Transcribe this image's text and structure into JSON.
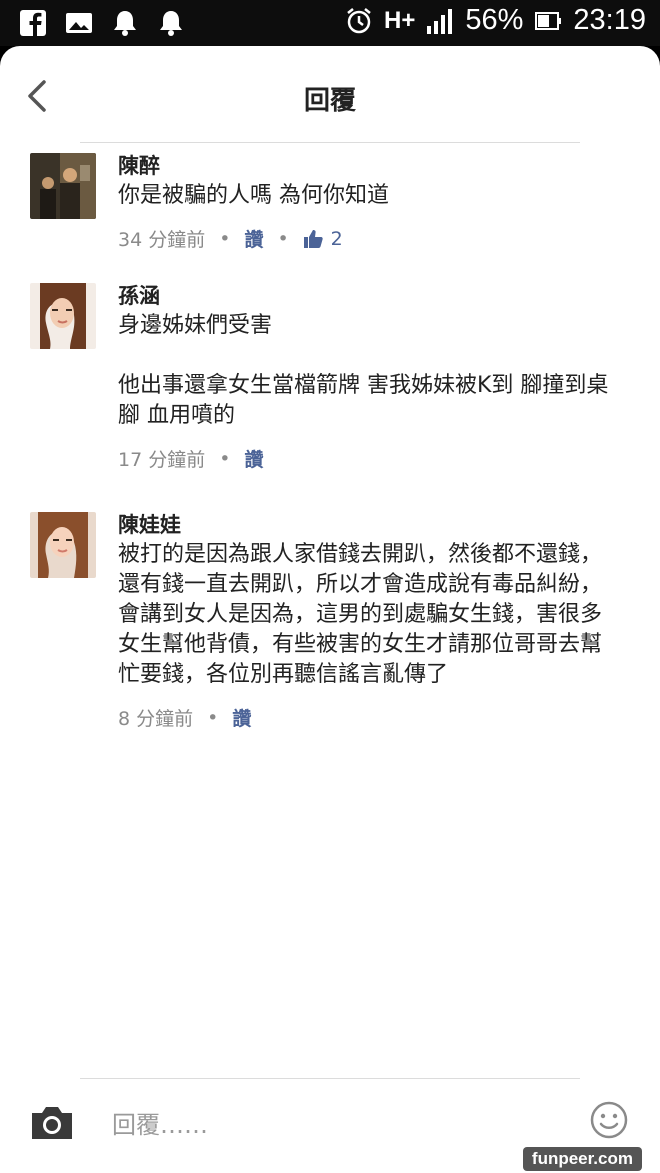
{
  "status_bar": {
    "battery_percent": "56%",
    "time": "23:19",
    "network": "H+",
    "icons": [
      "facebook-icon",
      "photo-icon",
      "bell-icon",
      "bell-icon",
      "alarm-icon",
      "signal-icon",
      "battery-icon"
    ]
  },
  "header": {
    "title": "回覆"
  },
  "comments": [
    {
      "name": "陳醉",
      "text": "你是被騙的人嗎 為何你知道",
      "time": "34 分鐘前",
      "like_label": "讚",
      "like_count": "2"
    },
    {
      "name": "孫涵",
      "text": "身邊姊妹們受害\n\n他出事還拿女生當檔箭牌 害我姊妹被K到 腳撞到桌腳 血用噴的",
      "time": "17 分鐘前",
      "like_label": "讚"
    },
    {
      "name": "陳娃娃",
      "text": "被打的是因為跟人家借錢去開趴，然後都不還錢，還有錢一直去開趴，所以才會造成說有毒品糾紛，會講到女人是因為，這男的到處騙女生錢，害很多女生幫他背債，有些被害的女生才請那位哥哥去幫忙要錢，各位別再聽信謠言亂傳了",
      "time": "8 分鐘前",
      "like_label": "讚"
    }
  ],
  "composer": {
    "placeholder": "回覆……"
  },
  "watermark": "funpeer.com",
  "colors": {
    "link": "#4b6397",
    "meta": "#8a8a8a",
    "text": "#222222"
  }
}
